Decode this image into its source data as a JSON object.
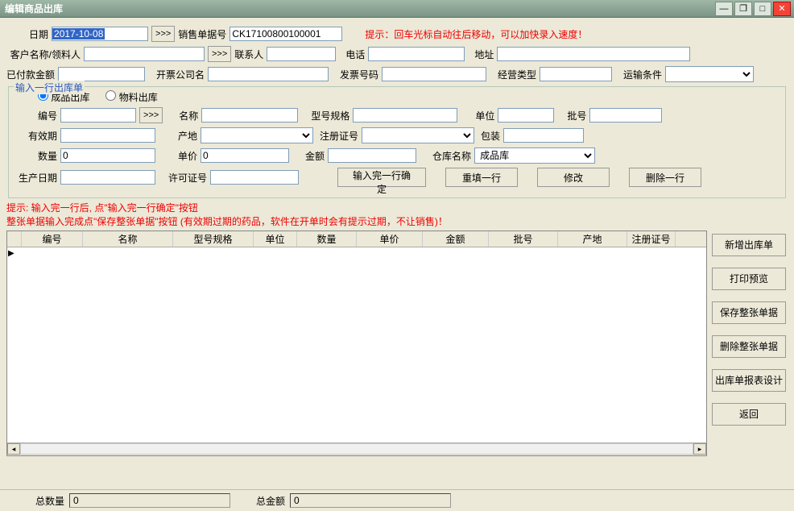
{
  "window": {
    "title": "编辑商品出库"
  },
  "header": {
    "date_label": "日期",
    "date_value": "2017-10-08",
    "arrows": ">>>",
    "order_label": "销售单据号",
    "order_value": "CK17100800100001",
    "hint": "提示：回车光标自动往后移动，可以加快录入速度！"
  },
  "row2": {
    "cust_label": "客户名称/领料人",
    "contact_label": "联系人",
    "phone_label": "电话",
    "addr_label": "地址"
  },
  "row3": {
    "paid_label": "已付款金额",
    "invco_label": "开票公司名",
    "invno_label": "发票号码",
    "biztype_label": "经营类型",
    "ship_label": "运输条件"
  },
  "fieldset": {
    "legend": "输入一行出库单",
    "radio1": "成品出库",
    "radio2": "物料出库",
    "code_label": "编号",
    "name_label": "名称",
    "spec_label": "型号规格",
    "unit_label": "单位",
    "batch_label": "批号",
    "expiry_label": "有效期",
    "origin_label": "产地",
    "regno_label": "注册证号",
    "pack_label": "包装",
    "qty_label": "数量",
    "qty_value": "0",
    "price_label": "单价",
    "price_value": "0",
    "amount_label": "金额",
    "wh_label": "仓库名称",
    "wh_value": "成品库",
    "mfg_label": "生产日期",
    "permit_label": "许可证号",
    "btn_confirm": "输入完一行确定",
    "btn_refill": "重填一行",
    "btn_modify": "修改",
    "btn_delete": "删除一行"
  },
  "hints": {
    "l1": "提示: 输入完一行后, 点\"输入完一行确定\"按钮",
    "l2": "整张单据输入完成点\"保存整张单据\"按钮 (有效期过期的药品，软件在开单时会有提示过期，不让销售)！"
  },
  "grid": {
    "cols": [
      "",
      "编号",
      "名称",
      "型号规格",
      "单位",
      "数量",
      "单价",
      "金额",
      "批号",
      "产地",
      "注册证号"
    ],
    "widths": [
      18,
      76,
      112,
      100,
      54,
      74,
      82,
      82,
      86,
      86,
      60
    ]
  },
  "right_buttons": [
    "新增出库单",
    "打印预览",
    "保存整张单据",
    "删除整张单据",
    "出库单报表设计",
    "返回"
  ],
  "footer": {
    "total_qty_label": "总数量",
    "total_qty_value": "0",
    "total_amt_label": "总金额",
    "total_amt_value": "0"
  }
}
